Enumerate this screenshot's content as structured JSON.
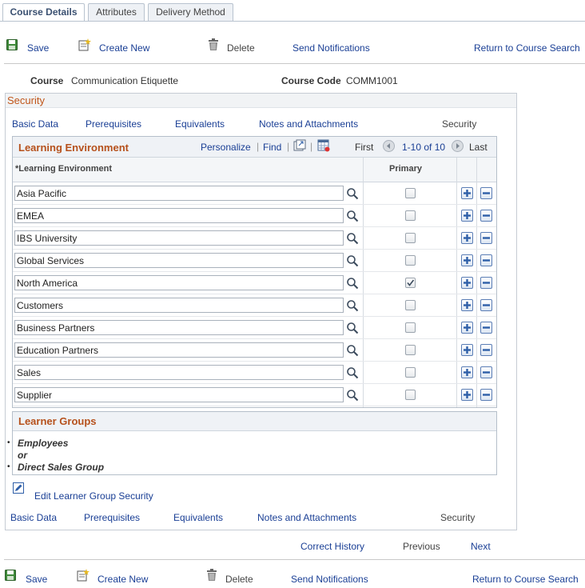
{
  "tabs": [
    "Course Details",
    "Attributes",
    "Delivery Method"
  ],
  "toolbar": {
    "save": "Save",
    "create_new": "Create New",
    "delete": "Delete",
    "send_notifications": "Send Notifications",
    "return": "Return to Course Search"
  },
  "course": {
    "course_label": "Course",
    "course_value": "Communication Etiquette",
    "code_label": "Course Code",
    "code_value": "COMM1001"
  },
  "security": {
    "title": "Security",
    "links": [
      "Basic Data",
      "Prerequisites",
      "Equivalents",
      "Notes and Attachments"
    ],
    "current": "Security"
  },
  "grid": {
    "title": "Learning Environment",
    "personalize": "Personalize",
    "find": "Find",
    "first": "First",
    "range": "1-10 of 10",
    "last": "Last",
    "col_environment": "*Learning Environment",
    "col_primary": "Primary",
    "rows": [
      {
        "value": "Asia Pacific",
        "primary": false
      },
      {
        "value": "EMEA",
        "primary": false
      },
      {
        "value": "IBS University",
        "primary": false
      },
      {
        "value": "Global Services",
        "primary": false
      },
      {
        "value": "North America",
        "primary": true
      },
      {
        "value": "Customers",
        "primary": false
      },
      {
        "value": "Business Partners",
        "primary": false
      },
      {
        "value": "Education Partners",
        "primary": false
      },
      {
        "value": "Sales",
        "primary": false
      },
      {
        "value": "Supplier",
        "primary": false
      }
    ]
  },
  "learner_groups": {
    "title": "Learner Groups",
    "items": [
      "Employees",
      "or",
      "Direct Sales Group"
    ],
    "edit_link": "Edit Learner Group Security"
  },
  "nav": {
    "correct_history": "Correct History",
    "previous": "Previous",
    "next": "Next"
  },
  "colors": {
    "link": "#1a3f95",
    "section_title": "#b6511c",
    "button_blue": "#2f5fa8"
  }
}
